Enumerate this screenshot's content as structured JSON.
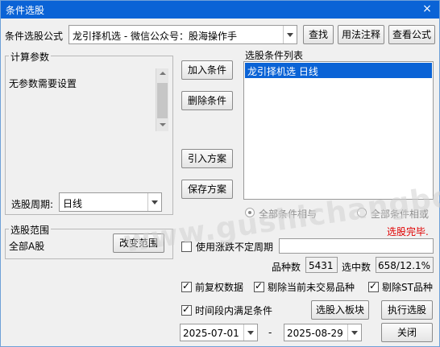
{
  "window": {
    "title": "条件选股",
    "close": "×"
  },
  "formula": {
    "label": "条件选股公式",
    "value": "龙引择机选  -  微信公众号：股海操作手",
    "buttons": {
      "find": "查找",
      "usage": "用法注释",
      "view": "查看公式"
    }
  },
  "params": {
    "group_title": "计算参数",
    "text": "无参数需要设置"
  },
  "period": {
    "label": "选股周期:",
    "value": "日线"
  },
  "actions": {
    "add": "加入条件",
    "delete": "删除条件",
    "import": "引入方案",
    "save": "保存方案"
  },
  "condition_list": {
    "title": "选股条件列表",
    "items": [
      "龙引择机选  日线"
    ]
  },
  "logic": {
    "and_label": "全部条件相与",
    "or_label": "全部条件相或"
  },
  "status": {
    "text": "选股完毕.",
    "color": "#e00000"
  },
  "range": {
    "group_title": "选股范围",
    "value": "全部A股",
    "change_button": "改变范围"
  },
  "irregular": {
    "label": "使用涨跌不定周期"
  },
  "stats": {
    "count_label": "品种数",
    "count_value": "5431",
    "selected_label": "选中数",
    "selected_value": "658/12.1%"
  },
  "options": {
    "forward_adjust": "前复权数据",
    "exclude_untraded": "剔除当前未交易品种",
    "exclude_st": "剔除ST品种",
    "time_range": "时间段内满足条件"
  },
  "dates": {
    "start": "2025-07-01",
    "separator": "-",
    "end": "2025-08-29"
  },
  "buttons": {
    "to_block": "选股入板块",
    "execute": "执行选股",
    "close": "关闭"
  },
  "watermark": {
    "text": "www.gushichangbong.com"
  },
  "colors": {
    "title_bar": "#0a63d6",
    "selection": "#0a63d6"
  }
}
